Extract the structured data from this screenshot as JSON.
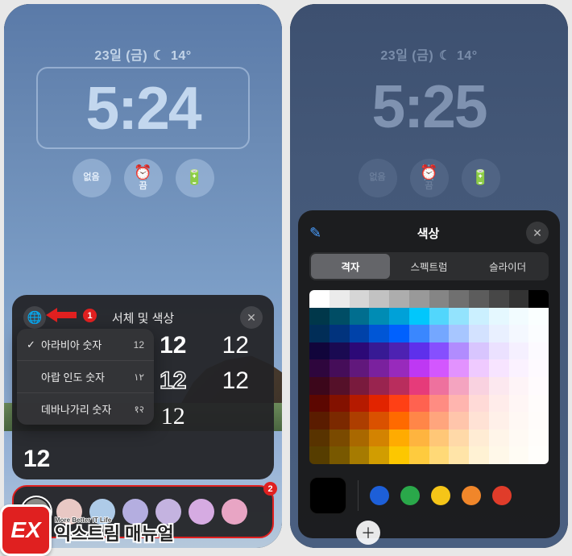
{
  "left": {
    "date": "23일 (금)",
    "weather_icon": "☾",
    "temp": "14°",
    "time": "5:24",
    "pills": [
      {
        "label": "없음",
        "icon": ""
      },
      {
        "label": "끔",
        "icon": "⏰"
      },
      {
        "label": "",
        "icon": "🔋"
      }
    ],
    "panel_title": "서체 및 색상",
    "callout1": "1",
    "dropdown": [
      {
        "label": "아라비아 숫자",
        "sample": "12",
        "checked": true
      },
      {
        "label": "아랍 인도 숫자",
        "sample": "١٢",
        "checked": false
      },
      {
        "label": "데바나가리 숫자",
        "sample": "१२",
        "checked": false
      }
    ],
    "font_samples": [
      "12",
      "12",
      "12",
      "12",
      "12",
      "12"
    ],
    "callout2": "2",
    "swatches": [
      "#8a8a86",
      "#e8c8c4",
      "#aecbe8",
      "#b4aee0",
      "#c4b3e0",
      "#d6abe2",
      "#e8a5c4"
    ]
  },
  "right": {
    "date": "23일 (금)",
    "weather_icon": "☾",
    "temp": "14°",
    "time": "5:25",
    "pills": [
      {
        "label": "없음",
        "icon": ""
      },
      {
        "label": "끔",
        "icon": "⏰"
      },
      {
        "label": "",
        "icon": "🔋"
      }
    ],
    "panel_title": "색상",
    "segments": [
      "격자",
      "스펙트럼",
      "슬라이더"
    ],
    "active_segment": 0,
    "presets": [
      "#1d5fd8",
      "#2aa84a",
      "#f5c518",
      "#f0862a",
      "#e03c2a"
    ],
    "preview": "#000000"
  },
  "watermark": {
    "badge": "EX",
    "sub": "More Better IT Life",
    "main": "익스트림 매뉴얼"
  },
  "grid_colors": [
    "#ffffff",
    "#ebebeb",
    "#d6d6d6",
    "#c2c2c2",
    "#adadad",
    "#999999",
    "#858585",
    "#707070",
    "#5c5c5c",
    "#474747",
    "#333333",
    "#000000",
    "#00374a",
    "#004d65",
    "#016e8f",
    "#008cb4",
    "#00a1d8",
    "#01c7fc",
    "#52d6fc",
    "#93e3fd",
    "#cbf0ff",
    "#e5f8ff",
    "#f2fcff",
    "#faffff",
    "#012d57",
    "#01337d",
    "#0042a9",
    "#0056d6",
    "#0061fe",
    "#3a87fe",
    "#74a7ff",
    "#a7c6ff",
    "#d3e2ff",
    "#e9f0ff",
    "#f4f8ff",
    "#fbfdff",
    "#11053b",
    "#1a0a52",
    "#2c0977",
    "#371a94",
    "#4d22b2",
    "#5e30eb",
    "#864ffe",
    "#b18cfe",
    "#d8c5fe",
    "#ebe1ff",
    "#f5f0ff",
    "#fcfaff",
    "#2e063d",
    "#450d59",
    "#61187c",
    "#7a219e",
    "#982abc",
    "#be38f3",
    "#d357fe",
    "#e292fe",
    "#efcaff",
    "#f7e4ff",
    "#fbf2ff",
    "#fefaff",
    "#3c071b",
    "#551029",
    "#791a3d",
    "#99244f",
    "#b92d5d",
    "#e63b7a",
    "#ee719e",
    "#f4a4c0",
    "#f9d2e0",
    "#fce8ef",
    "#fef4f7",
    "#fffbfd",
    "#5c0701",
    "#831100",
    "#b51a00",
    "#e22400",
    "#ff4015",
    "#ff6250",
    "#ff8c82",
    "#ffb5af",
    "#ffdad7",
    "#ffecea",
    "#fff6f5",
    "#fffcfb",
    "#5a1c00",
    "#7b2900",
    "#ad3e00",
    "#da5100",
    "#ff6a00",
    "#ff8648",
    "#ffa57d",
    "#ffc5ab",
    "#ffe2d5",
    "#fff0e9",
    "#fff8f4",
    "#fffcfa",
    "#583300",
    "#7a4a00",
    "#a96800",
    "#d38301",
    "#ffab01",
    "#feb43f",
    "#ffc777",
    "#ffd9a8",
    "#ffecd4",
    "#fff5e9",
    "#fffaf4",
    "#fffdfa",
    "#563d00",
    "#785800",
    "#a67b01",
    "#d19d01",
    "#fdc700",
    "#fecb3e",
    "#ffd977",
    "#ffe4a8",
    "#fff2d4",
    "#fff8e9",
    "#fffcf4",
    "#fffefb"
  ]
}
